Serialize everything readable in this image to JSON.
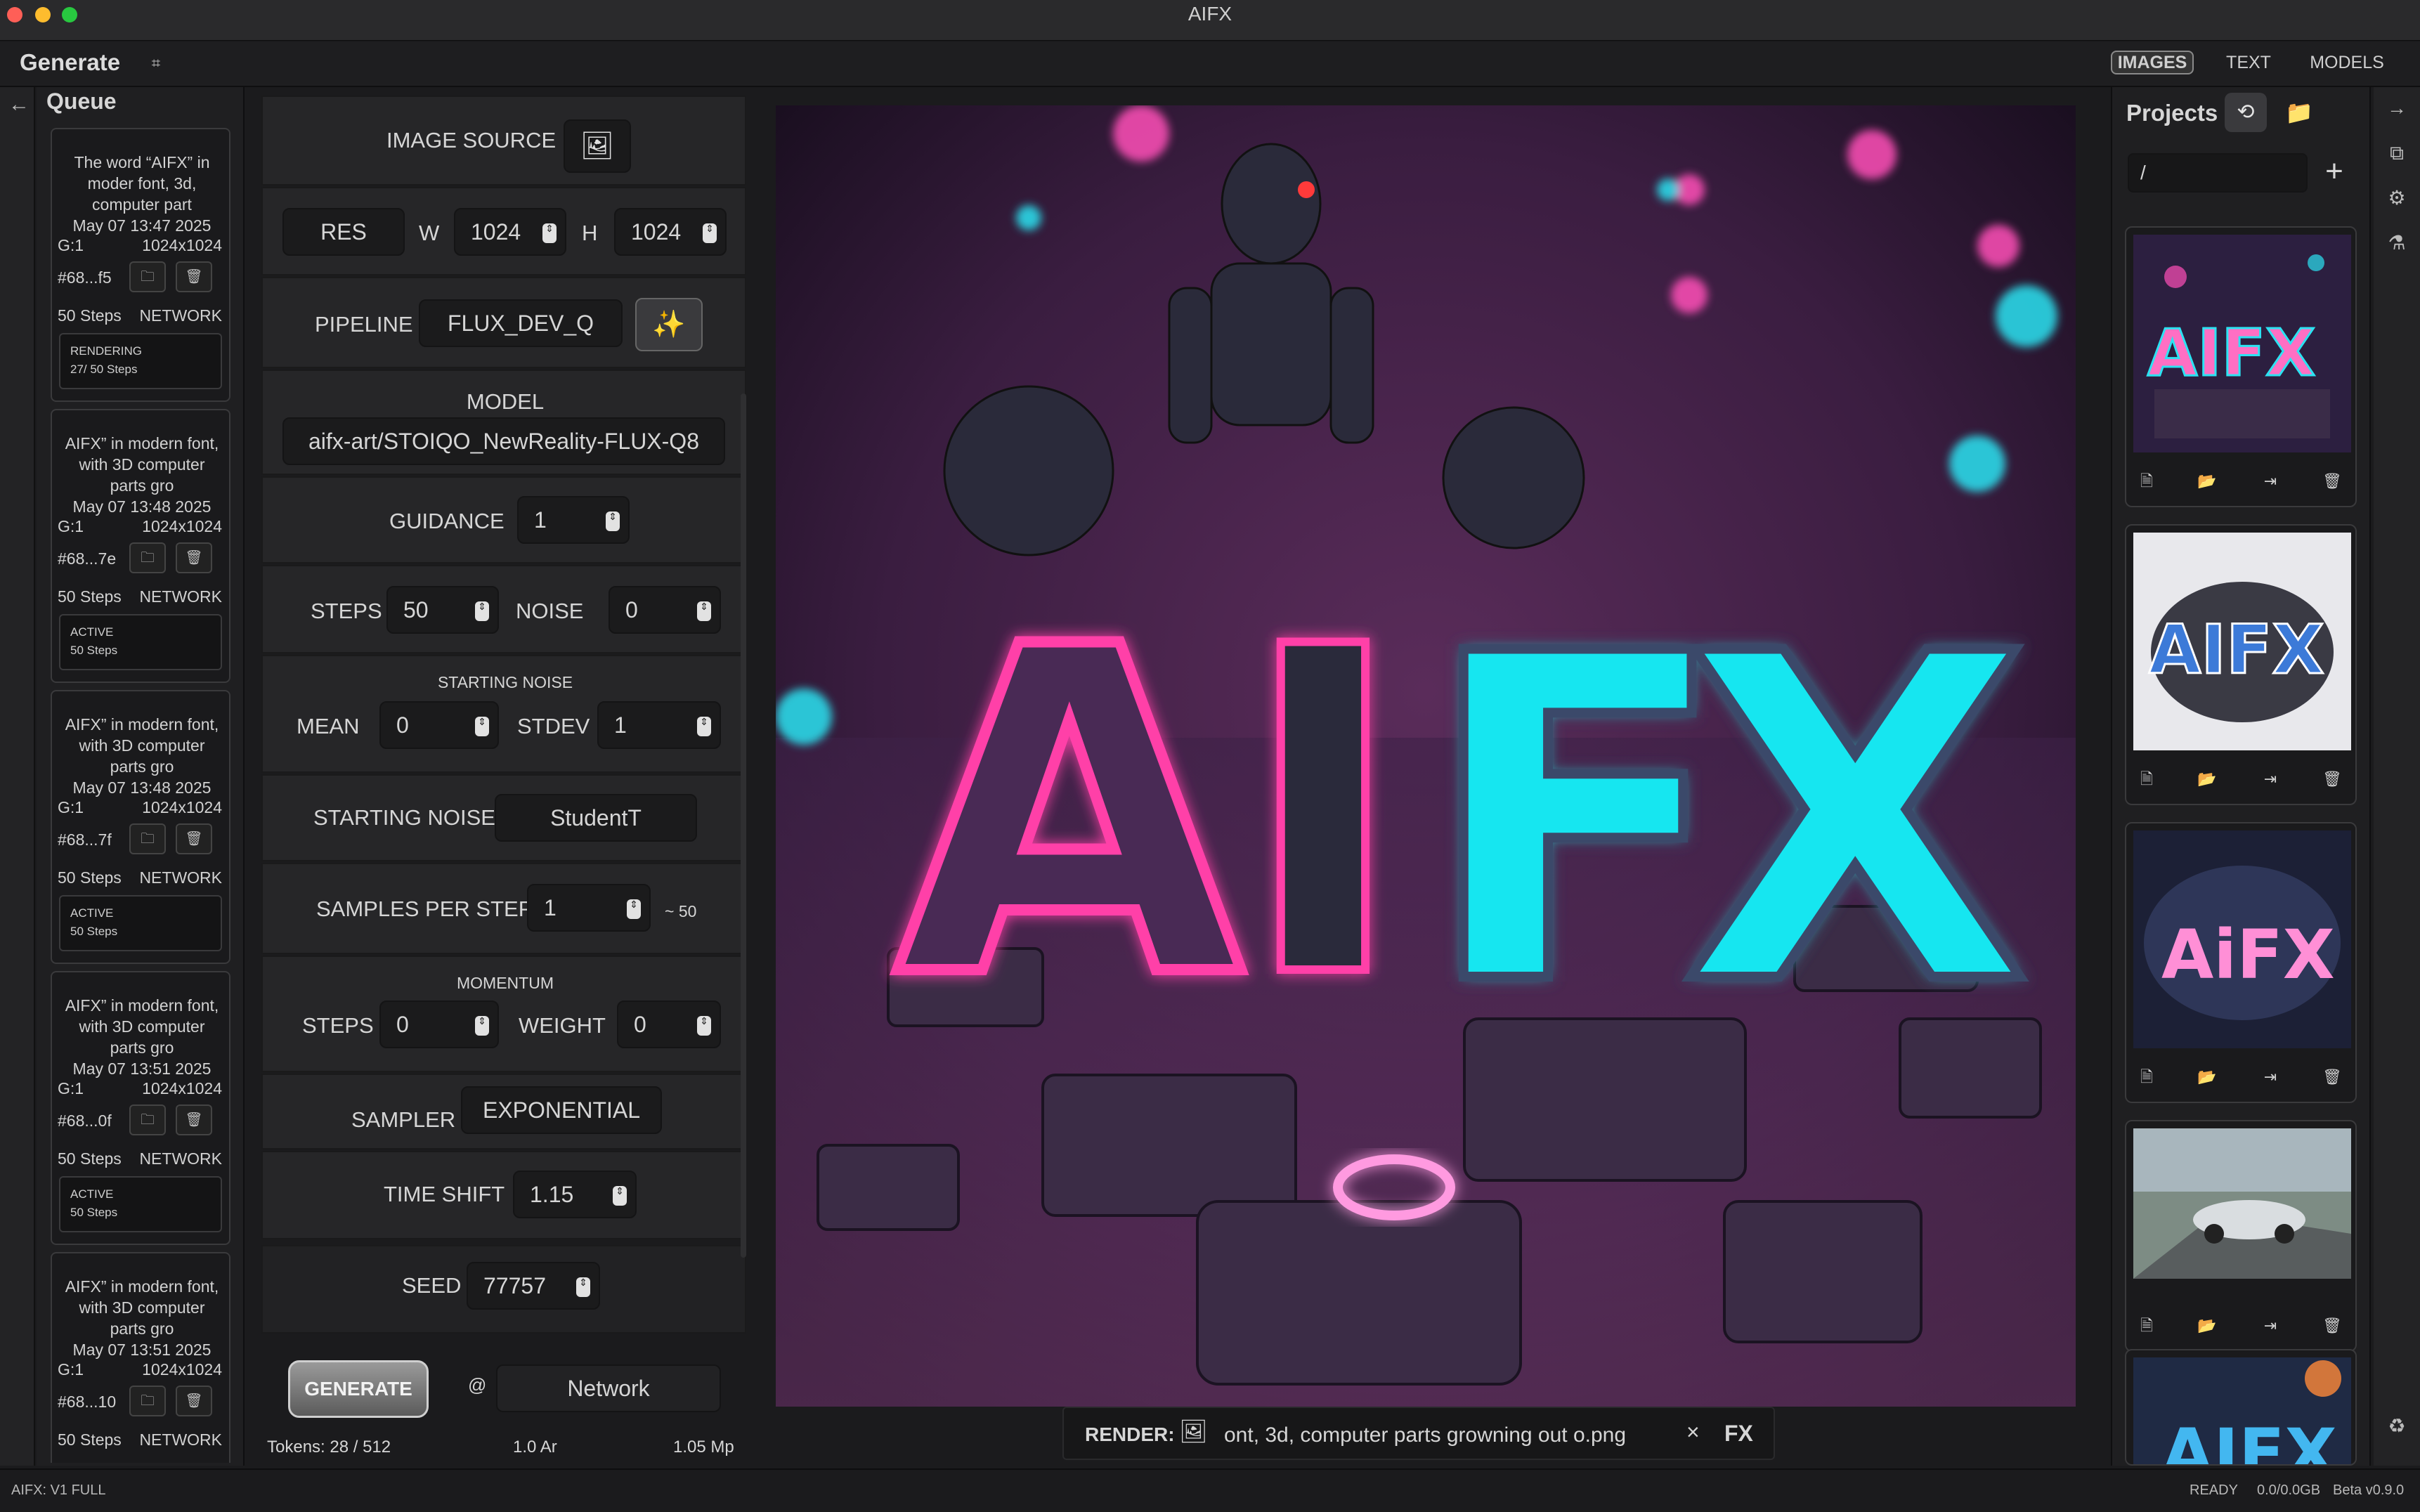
{
  "window": {
    "title": "AIFX"
  },
  "header": {
    "title": "Generate",
    "tabs": [
      "IMAGES",
      "TEXT",
      "MODELS"
    ]
  },
  "queue": {
    "title": "Queue",
    "items": [
      {
        "prompt": "The word “AIFX” in moder font, 3d, computer part",
        "date": "May 07 13:47 2025",
        "g": "G:1",
        "res": "1024x1024",
        "hash": "#68...f5",
        "steps": "50 Steps",
        "source": "NETWORK",
        "status": "RENDERING",
        "status_detail": "27/ 50 Steps"
      },
      {
        "prompt": "AIFX” in modern font, with 3D computer parts gro",
        "date": "May 07 13:48 2025",
        "g": "G:1",
        "res": "1024x1024",
        "hash": "#68...7e",
        "steps": "50 Steps",
        "source": "NETWORK",
        "status": "ACTIVE",
        "status_detail": "50 Steps"
      },
      {
        "prompt": "AIFX” in modern font, with 3D computer parts gro",
        "date": "May 07 13:48 2025",
        "g": "G:1",
        "res": "1024x1024",
        "hash": "#68...7f",
        "steps": "50 Steps",
        "source": "NETWORK",
        "status": "ACTIVE",
        "status_detail": "50 Steps"
      },
      {
        "prompt": "AIFX” in modern font, with 3D computer parts gro",
        "date": "May 07 13:51 2025",
        "g": "G:1",
        "res": "1024x1024",
        "hash": "#68...0f",
        "steps": "50 Steps",
        "source": "NETWORK",
        "status": "ACTIVE",
        "status_detail": "50 Steps"
      },
      {
        "prompt": "AIFX” in modern font, with 3D computer parts gro",
        "date": "May 07 13:51 2025",
        "g": "G:1",
        "res": "1024x1024",
        "hash": "#68...10",
        "steps": "50 Steps",
        "source": "NETWORK",
        "status": "",
        "status_detail": ""
      }
    ]
  },
  "settings": {
    "image_source_label": "IMAGE SOURCE",
    "res_label": "RES",
    "w_label": "W",
    "w_value": "1024",
    "h_label": "H",
    "h_value": "1024",
    "pipeline_label": "PIPELINE",
    "pipeline_value": "FLUX_DEV_Q",
    "model_label": "MODEL",
    "model_value": "aifx-art/STOIQO_NewReality-FLUX-Q8",
    "guidance_label": "GUIDANCE",
    "guidance_value": "1",
    "steps_label": "STEPS",
    "steps_value": "50",
    "noise_label": "NOISE",
    "noise_value": "0",
    "starting_noise_header": "STARTING NOISE",
    "mean_label": "MEAN",
    "mean_value": "0",
    "stdev_label": "STDEV",
    "stdev_value": "1",
    "starting_noise_label": "STARTING NOISE",
    "starting_noise_value": "StudentT",
    "samples_label": "SAMPLES PER STEP",
    "samples_value": "1",
    "samples_approx": "~ 50",
    "momentum_header": "MOMENTUM",
    "m_steps_label": "STEPS",
    "m_steps_value": "0",
    "weight_label": "WEIGHT",
    "weight_value": "0",
    "sampler_label": "SAMPLER",
    "sampler_value": "EXPONENTIAL",
    "timeshift_label": "TIME SHIFT",
    "timeshift_value": "1.15",
    "seed_label": "SEED",
    "seed_value": "77757",
    "generate_label": "GENERATE",
    "at_label": "@",
    "target_value": "Network",
    "tokens": "Tokens: 28 / 512",
    "ar": "1.0 Ar",
    "mp": "1.05 Mp"
  },
  "viewer": {
    "letters": [
      "A",
      "I",
      "F",
      "X"
    ],
    "render_label": "RENDER:",
    "render_file": "ont, 3d, computer parts growning out o.png",
    "close": "×",
    "fx": "FX"
  },
  "projects": {
    "title": "Projects",
    "path": "/",
    "thumbs": [
      {
        "text": "AIFX"
      },
      {
        "text": "AIFX"
      },
      {
        "text": "AiFX"
      },
      {
        "text": ""
      },
      {
        "text": "AIFX"
      }
    ]
  },
  "status": {
    "left": "AIFX: V1 FULL",
    "ready": "READY",
    "mem": "0.0/0.0GB",
    "version": "Beta v0.9.0"
  },
  "colors": {
    "bg": "#1b1b1d",
    "panel": "#262628",
    "neon_pink": "#ff3fa8",
    "neon_cyan": "#19e6f0",
    "scene_purple": "#7a3f78"
  }
}
